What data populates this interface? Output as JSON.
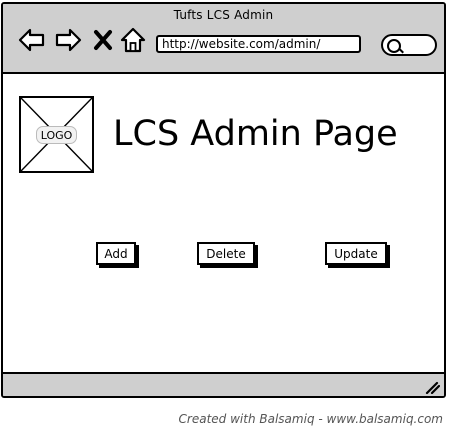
{
  "window": {
    "title": "Tufts LCS Admin"
  },
  "toolbar": {
    "url": "http://website.com/admin/",
    "icons": [
      "back-arrow-icon",
      "forward-arrow-icon",
      "close-x-icon",
      "home-icon",
      "search-icon"
    ]
  },
  "logo": {
    "label": "LOGO"
  },
  "page": {
    "title": "LCS Admin Page"
  },
  "buttons": {
    "add": "Add",
    "delete": "Delete",
    "update": "Update"
  },
  "footer": {
    "credit": "Created with Balsamiq - www.balsamiq.com"
  }
}
